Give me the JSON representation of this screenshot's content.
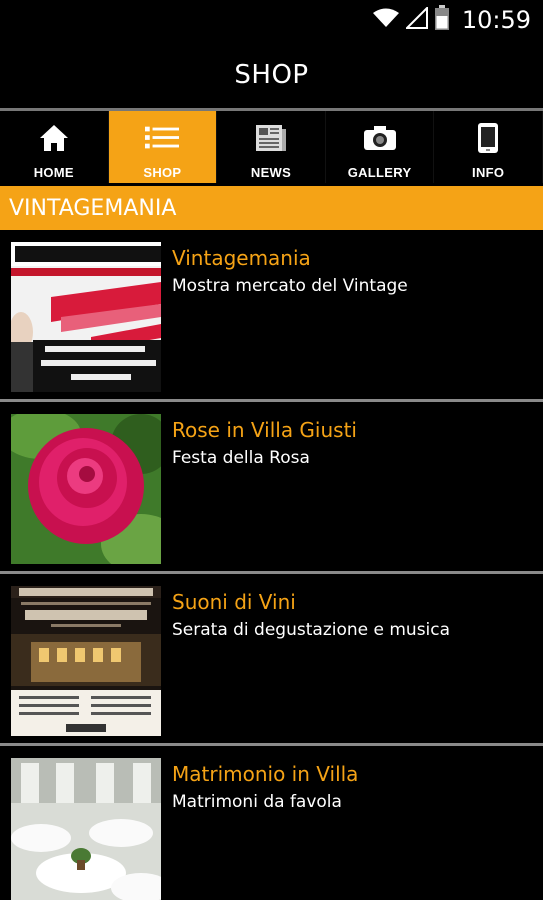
{
  "status_bar": {
    "time": "10:59",
    "icons": [
      "wifi-icon",
      "signal-icon",
      "battery-icon"
    ]
  },
  "action_bar": {
    "title": "SHOP"
  },
  "tabs": [
    {
      "label": "HOME",
      "icon": "home-icon",
      "active": false
    },
    {
      "label": "SHOP",
      "icon": "list-icon",
      "active": true
    },
    {
      "label": "NEWS",
      "icon": "newspaper-icon",
      "active": false
    },
    {
      "label": "GALLERY",
      "icon": "camera-icon",
      "active": false
    },
    {
      "label": "INFO",
      "icon": "phone-icon",
      "active": false
    }
  ],
  "section": {
    "title": "VINTAGEMANIA"
  },
  "items": [
    {
      "title": "Vintagemania",
      "subtitle": "Mostra mercato del Vintage",
      "thumb": "vintagemania-poster"
    },
    {
      "title": "Rose in Villa Giusti",
      "subtitle": "Festa della Rosa",
      "thumb": "pink-rose-photo"
    },
    {
      "title": "Suoni di Vini",
      "subtitle": "Serata di degustazione e musica",
      "thumb": "villa-night-poster"
    },
    {
      "title": "Matrimonio in Villa",
      "subtitle": "Matrimoni da favola",
      "thumb": "banquet-hall-photo"
    }
  ],
  "colors": {
    "accent": "#f5a316",
    "background": "#000000",
    "divider": "#8a8a8a"
  }
}
